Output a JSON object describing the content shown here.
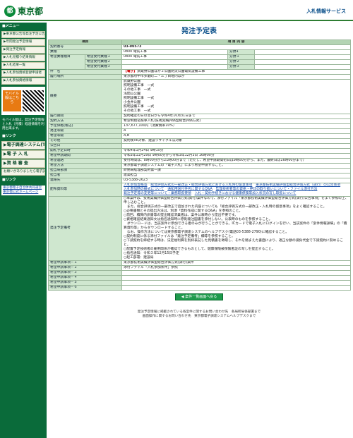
{
  "header": {
    "logo_mark": "都",
    "logo_text": "東京都",
    "right_link": "入札情報サービス"
  },
  "sidebar": {
    "menu_title": "■メニュー",
    "items": [
      "▶東京都公告等発注予定公告",
      "▶年間発注予定情報",
      "▶発注予定情報",
      "▶入札見積り結果情報",
      "▶入札結果一覧",
      "▶入札参加資格登録申請者",
      "▶入札参加資格情報"
    ],
    "mobile_label": "モバイル版はこちら",
    "mobile_note": "モバイル版は、発注予定情報と入札（見積）経過情報を利用出来ます。",
    "links_title": "■リンク",
    "big_items": [
      "▶電子調達システム(TOP)",
      "▶電 子 入 札",
      "▶資 格 審 査"
    ],
    "check": "お願いがありましたら電子調達チャットボット",
    "links_title2": "■リンク",
    "bottom_links": [
      "東京都電子自治体共同運営",
      "東京都公式ホームページ"
    ]
  },
  "main": {
    "title": "発注予定表",
    "col_item": "項目",
    "col_content": "項 目 内 容",
    "rows": {
      "contract_no": {
        "label": "契約番号",
        "value": "03-00573"
      },
      "business": {
        "label": "業種",
        "value": "0800 電気工事",
        "sub_label": "分野1",
        "sub_value": ""
      },
      "hope_type": {
        "label": "希望業種種目",
        "e1": "希望受付業種１",
        "v1": "0800 電気工事",
        "e2": "希望受付業種２",
        "e3": "希望受付業種３",
        "s1": "分野１",
        "s2": "分野２",
        "s3": "分野３"
      },
      "subject": {
        "label": "件　名",
        "tag": "【電子】",
        "value": "武蔵野公園ほか２公園防災公園電気設備工事"
      },
      "place": {
        "label": "履行場所",
        "value": "東京都府中市多磨町二・三丁目地内ほか"
      },
      "summary": {
        "label": "概要",
        "lines": [
          "武蔵野公園",
          "照明設備工事　一式",
          "その他工事　一式",
          "浅間山公園",
          "照明設備工事　一式",
          "小金井公園",
          "照明設備工事　一式",
          "その他工事　一式"
        ]
      },
      "term": {
        "label": "履行期間",
        "value": "契約確定の日の翌日から令和4年10月31日まで"
      },
      "method": {
        "label": "契約方法",
        "value": "希望制指名競争入札(技術実績評価型総合評価方式)"
      },
      "price": {
        "label": "予定価格(税込)",
        "value": "137,677,100円（消費税率10%）"
      },
      "grade": {
        "label": "発注等級",
        "value": "A"
      },
      "hope_grade": {
        "label": "希望等級",
        "value": "A,B"
      },
      "other": {
        "label": "その他",
        "value": "契約後VE対象、建設リサイクル法対象"
      },
      "announce": {
        "label": "公告日",
        "value": ""
      },
      "open": {
        "label": "開札予定日時",
        "value": "令和4年1月24日 9時15分"
      },
      "period": {
        "label": "希望申請期間",
        "value": "令和3年11月29日 9時00分から令和3年12月3日 16時00分"
      },
      "hope": {
        "label": "希望連絡",
        "value": "受付時間は、8時00分から21時00分まで（ただし、希望申請期間初日は9時00分から、また、最終日は16時00分まで）"
      },
      "how": {
        "label": "希望方法",
        "value": "東京都電子調達システムの「電子入札」により希望申請すること。"
      },
      "dept": {
        "label": "担当局部課",
        "value": "財務局経理部契約第一課"
      },
      "person": {
        "label": "担当者",
        "value": "建築担当"
      },
      "tel": {
        "label": "連絡先",
        "value": "03-5388-2623"
      },
      "files": {
        "label": "配布資料等",
        "links": [
          "入札参加資格等",
          "総合評価方式の一部改正・総合評価方式における入札時の留意事項",
          "東京都技術実績評価型総合評価方式（試行）の公告事項",
          "入札参加時の様式について",
          "通知用送付件名に関するQ&A",
          "監理技術者等の資格・押印の取り扱いについて・ファイル添付方法",
          "発注予定等の変更等について・業務取扱要領",
          "入札・契約手続きにおける健康保険等加入状況の写し取扱について"
        ]
      },
      "notes": {
        "label": "発注予定備考",
        "lines": [
          "○本案件は、技術実績評価型総合評価方式(試行)案件なので、添付ファイル「東京都技術実績評価型総合評価方式(試行)公告事項」をよく参照の上、申し込むこと。",
          "　また、総合評価方式の一部改正で追加された内容についても「総合評価方式の一部改正・入札時の留意事項」をよく確認すること。",
          "○必要書類とその提出方法は、別添「資料作成に関するQ&A」を参照のこと。",
          "○前回、積算内訳書等の提出確認済業者は、案件公表時から提出不要です。",
          "○資格確認結果通知文は指名通知時に原則発注図書を添付しない。公表時のものを参照すること。",
          "　ダウンロードは、当該案件に参加できる者のみが行うことができる。ICカードで電子入札にログインを行い、当該案件の「案件情報詳細」の「積算資料等」からダウンロードすること。",
          "　なお、操作方法については東京都電子調達システムのヘルプデスク(電話03-5388-2790)に確認すること。",
          "○契約制度に係る添付ファイルは「発注予定備考」欄等を参照すること。",
          "○下請契約を締結する時は、法定福利費を別枠表記した見積書を徴取し、それを踏まえた書面により、適正な額の請負代金で下請契約に努めること。",
          "○配置予定技術者の雇用関係が確認できるものとして、健康保険被保険者証の写しを提出すること。",
          "○指名通知：令和３年12月15日予定",
          "○起工部署：建設局"
        ]
      },
      "attach": [
        {
          "label": "希望申請事項－１",
          "value": "東京都技術実績評価型総合評価方式(試行)案件"
        },
        {
          "label": "希望申請事項－２",
          "value": "添付ファイル「入札参加条件」参照"
        },
        {
          "label": "希望申請事項－３",
          "value": ""
        },
        {
          "label": "希望申請事項－４",
          "value": ""
        },
        {
          "label": "希望申請事項－５",
          "value": ""
        },
        {
          "label": "希望申請事項－６",
          "value": ""
        }
      ]
    },
    "back_label": "◀ 案件一覧画面へ戻る",
    "footer1": "発注予定情報に掲載されている各案件に関するお問い合わせ先　各局所局係部署まで",
    "footer2": "画面操作に関するお問い合わせ先　東京都電子調達システムヘルプデスクまで"
  }
}
